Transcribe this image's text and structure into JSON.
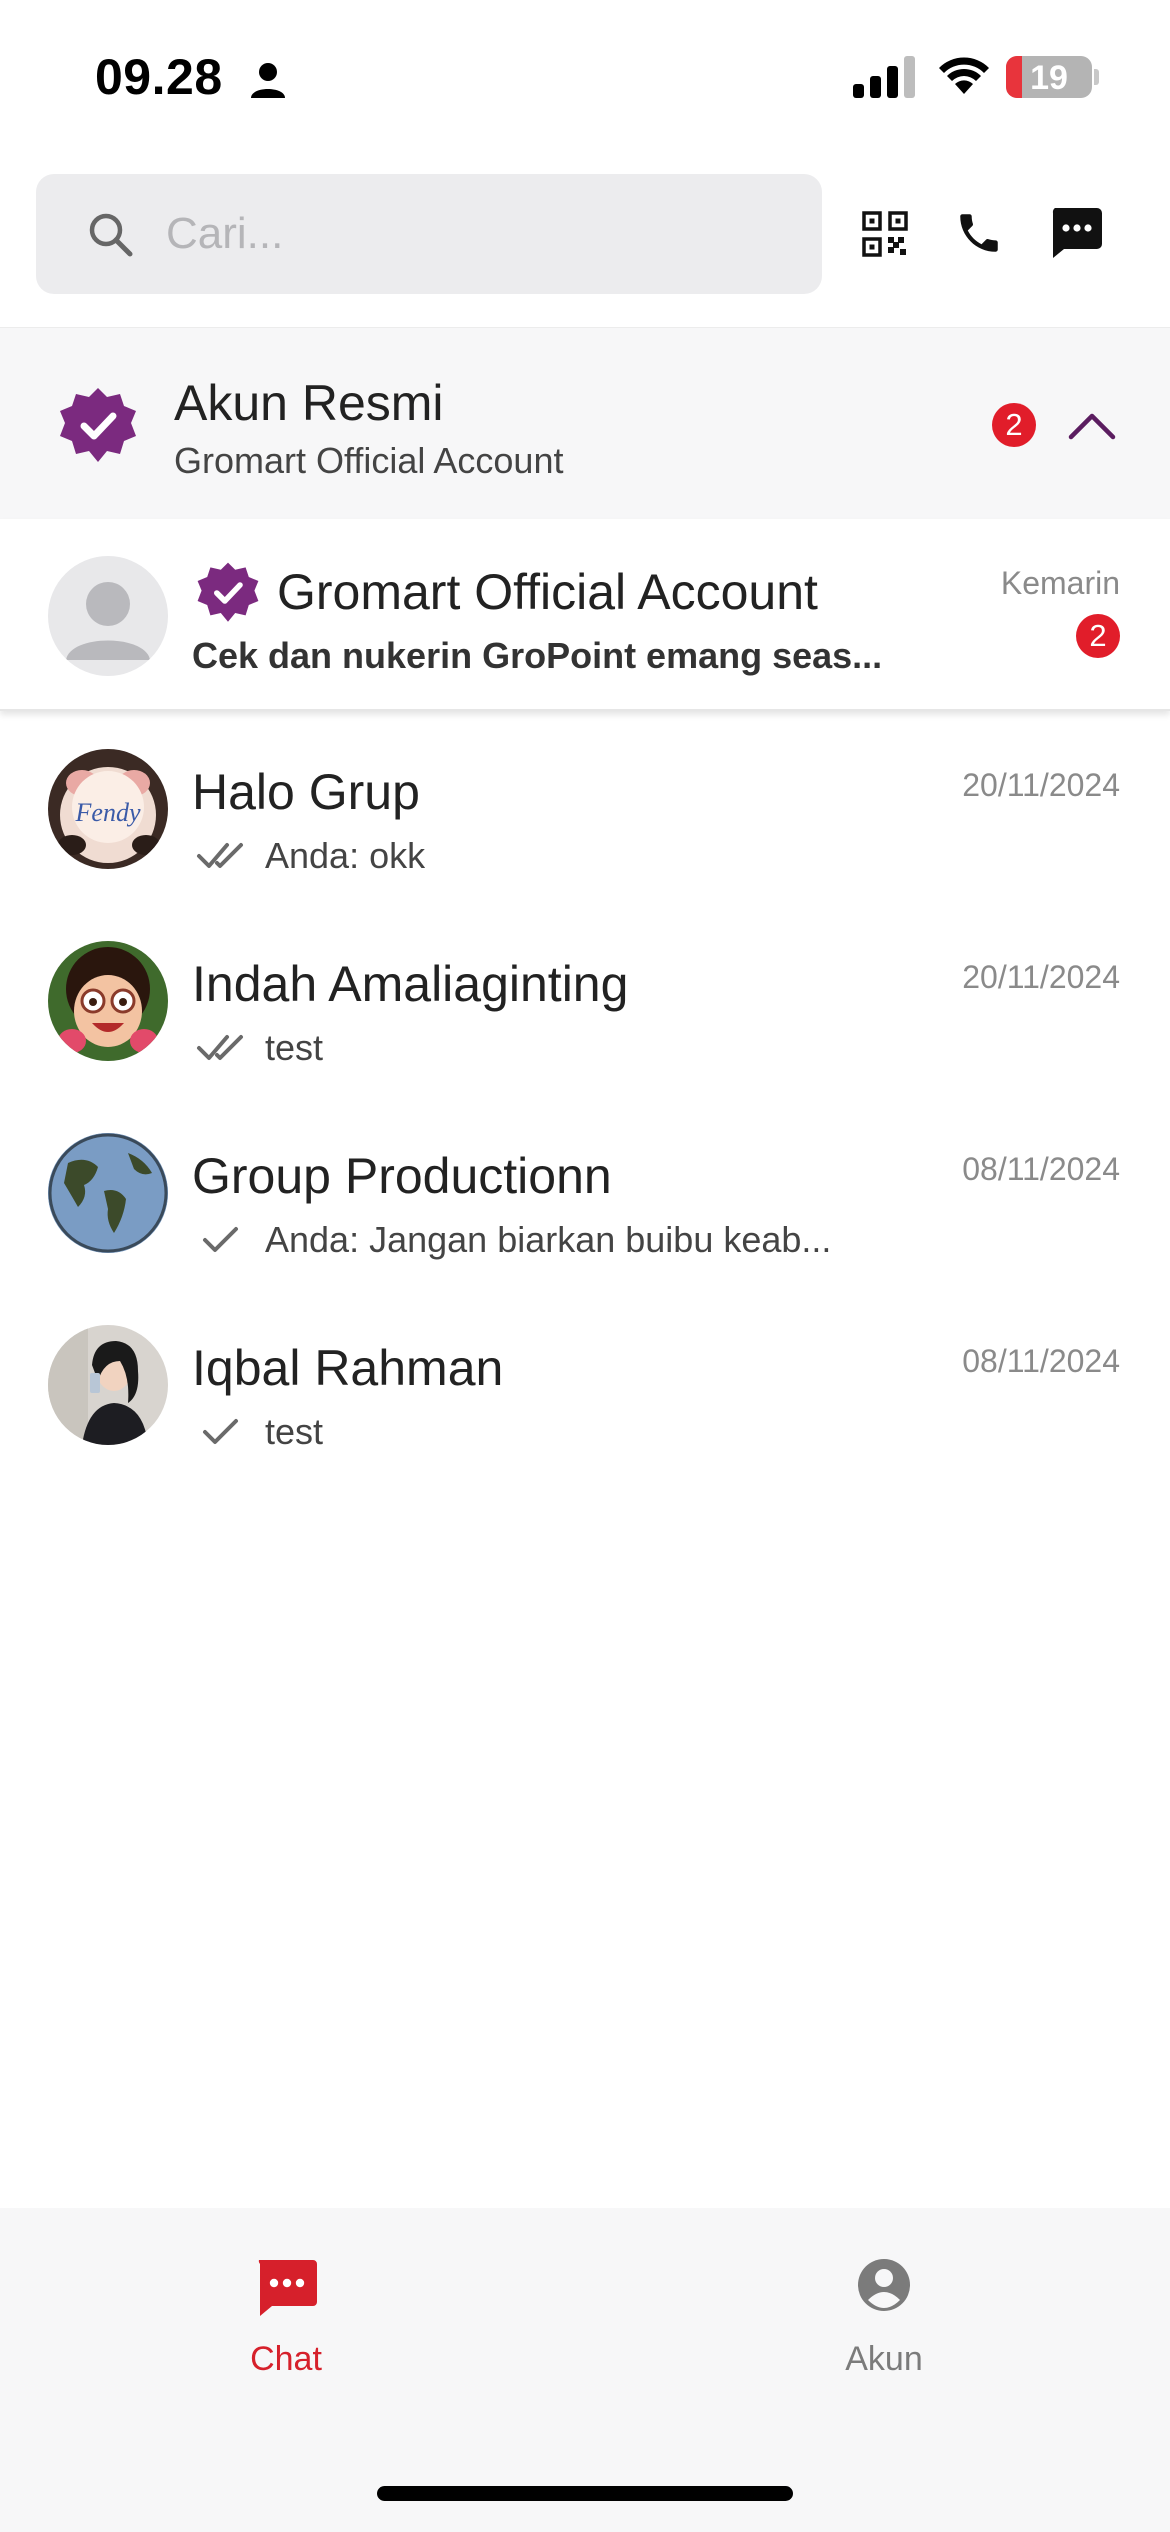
{
  "status_bar": {
    "time": "09.28",
    "battery": "19",
    "battery_level_percent": 19
  },
  "search": {
    "placeholder": "Cari..."
  },
  "colors": {
    "brand_purple": "#7b2a7f",
    "badge_red": "#e11d2a",
    "active_red": "#d6202b",
    "text_grey": "#8a8a8a"
  },
  "icons": {
    "status": [
      "person-icon",
      "signal-icon",
      "wifi-icon",
      "battery-icon"
    ],
    "toolbar": [
      "qr-code-icon",
      "phone-icon",
      "message-icon"
    ]
  },
  "official_section": {
    "title": "Akun Resmi",
    "subtitle": "Gromart Official Account",
    "unread": "2",
    "expanded": true
  },
  "official_chat": {
    "name": "Gromart Official Account",
    "snippet": "Cek dan nukerin GroPoint emang seas...",
    "date": "Kemarin",
    "unread": "2",
    "verified": true
  },
  "chats": [
    {
      "name": "Halo Grup",
      "snippet": "Anda: okk",
      "date": "20/11/2024",
      "status": "read-double-tick"
    },
    {
      "name": "Indah Amaliaginting",
      "snippet": "test",
      "date": "20/11/2024",
      "status": "read-double-tick"
    },
    {
      "name": "Group Productionn",
      "snippet": "Anda: Jangan biarkan buibu keab...",
      "date": "08/11/2024",
      "status": "sent-single-tick"
    },
    {
      "name": "Iqbal Rahman",
      "snippet": "test",
      "date": "08/11/2024",
      "status": "sent-single-tick"
    }
  ],
  "bottom_nav": [
    {
      "label": "Chat",
      "active": true
    },
    {
      "label": "Akun",
      "active": false
    }
  ]
}
